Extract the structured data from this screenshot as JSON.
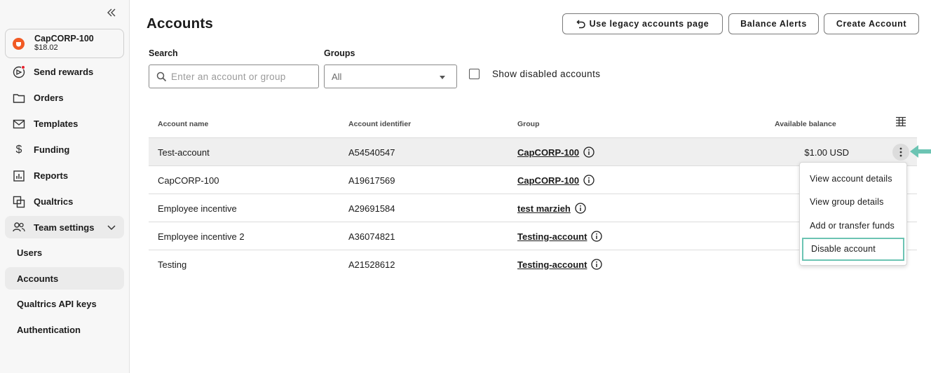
{
  "sidebar": {
    "org": {
      "name": "CapCORP-100",
      "balance": "$18.02"
    },
    "nav": [
      {
        "label": "Send rewards",
        "icon": "send-rewards-icon"
      },
      {
        "label": "Orders",
        "icon": "folder-icon"
      },
      {
        "label": "Templates",
        "icon": "mail-icon"
      },
      {
        "label": "Funding",
        "icon": "dollar-icon"
      },
      {
        "label": "Reports",
        "icon": "bar-chart-icon"
      },
      {
        "label": "Qualtrics",
        "icon": "qualtrics-icon"
      }
    ],
    "team_settings": {
      "label": "Team settings",
      "items": [
        "Users",
        "Accounts",
        "Qualtrics API keys",
        "Authentication"
      ]
    }
  },
  "header": {
    "title": "Accounts",
    "legacy_label": "Use legacy accounts page",
    "alerts_label": "Balance Alerts",
    "create_label": "Create Account"
  },
  "filters": {
    "search_label": "Search",
    "search_placeholder": "Enter an account or group",
    "groups_label": "Groups",
    "groups_value": "All",
    "show_disabled_label": "Show disabled accounts"
  },
  "table": {
    "headers": [
      "Account name",
      "Account identifier",
      "Group",
      "Available balance"
    ],
    "rows": [
      {
        "name": "Test-account",
        "identifier": "A54540547",
        "group": "CapCORP-100",
        "balance": "$1.00 USD"
      },
      {
        "name": "CapCORP-100",
        "identifier": "A19617569",
        "group": "CapCORP-100",
        "balance": ""
      },
      {
        "name": "Employee incentive",
        "identifier": "A29691584",
        "group": "test marzieh",
        "balance": ""
      },
      {
        "name": "Employee incentive 2",
        "identifier": "A36074821",
        "group": "Testing-account",
        "balance": ""
      },
      {
        "name": "Testing",
        "identifier": "A21528612",
        "group": "Testing-account",
        "balance": ""
      }
    ]
  },
  "menu": {
    "items": [
      "View account details",
      "View group details",
      "Add or transfer funds",
      "Disable account"
    ]
  },
  "colors": {
    "accent": "#6cc4b3",
    "brand": "#f15a24",
    "notification": "#e8212d"
  }
}
